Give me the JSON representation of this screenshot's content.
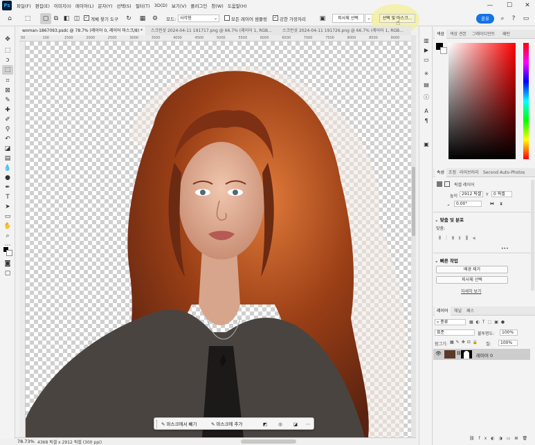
{
  "menu": {
    "items": [
      "파일(F)",
      "편집(E)",
      "이미지(I)",
      "레이어(L)",
      "문자(Y)",
      "선택(S)",
      "필터(T)",
      "3D(D)",
      "보기(V)",
      "플러그인",
      "창(W)",
      "도움말(H)"
    ],
    "window_controls": [
      "—",
      "☐",
      "✕"
    ]
  },
  "options_bar": {
    "enhance_edges_label": "개체 찾기 도구",
    "mode_label": "모드:",
    "mode_value": "사각형",
    "sample_all_layers_label": "모든 레이어 샘플링",
    "hard_edge_label": "강한 가장자리",
    "select_subject_label": "피사체 선택",
    "select_and_mask_label": "선택 및 마스크...",
    "share_label": "공유"
  },
  "document_tabs": [
    "woman-1867093.psdc @ 78.7% (레이어 0, 레이어 마스크/8) *",
    "스크린샷 2024-04-11 191717.png @ 66.7% (레이어 1, RGB...",
    "스크린샷 2024-04-11 191726.png @ 66.7% (레이어 1, RGB..."
  ],
  "ruler_marks": [
    "50",
    "100",
    "1500",
    "2000",
    "2500",
    "3000",
    "3500",
    "4000",
    "4500",
    "5000",
    "5500",
    "6000",
    "6500",
    "7000",
    "7500",
    "8000",
    "8500",
    "9000"
  ],
  "status": {
    "zoom": "78.73%",
    "doc_info": "4368 픽셀 x 2912 픽셀 (300 ppi)"
  },
  "contextual_taskbar": {
    "refine_label": "마스크에서 빼기",
    "add_label": "마스크에 추가"
  },
  "color_panel": {
    "tabs": [
      "색상",
      "색상 견본",
      "그레이디언트",
      "패턴"
    ]
  },
  "properties_panel": {
    "tabs": [
      "속성",
      "조정",
      "라이브러리",
      "Second Auto-Photos"
    ],
    "layer_kind": "픽셀 레이어",
    "height_label": "높이",
    "height_value": "2912 픽셀",
    "y_label": "Y",
    "y_value": "0 픽셀",
    "angle_value": "0.00°",
    "align_section": "맞춤 및 분포",
    "align_label": "맞춤:",
    "quick_actions_section": "빠른 작업",
    "remove_bg_button": "배경 제거",
    "select_subject_button": "피사체 선택",
    "more_link": "자세히 보기"
  },
  "layers_panel": {
    "tabs": [
      "레이어",
      "채널",
      "패스"
    ],
    "filter_kind": "종류",
    "blend_mode": "표준",
    "opacity_label": "불투명도:",
    "opacity_value": "100%",
    "lock_label": "잠그기:",
    "fill_label": "칠:",
    "fill_value": "100%",
    "layers": [
      {
        "name": "레이어 0"
      }
    ]
  },
  "colors": {
    "accent_blue": "#1473e6",
    "highlight_yellow": "#f3efa2",
    "hair": "#8a3513",
    "sweater": "#4a4440"
  }
}
